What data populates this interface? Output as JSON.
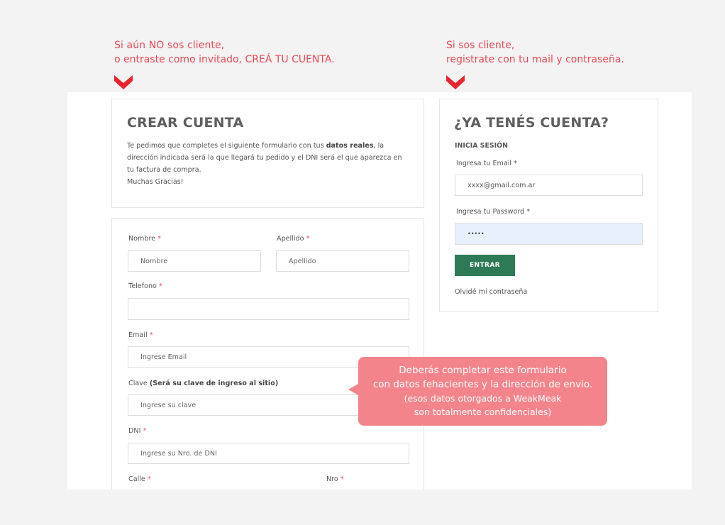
{
  "annotations": {
    "left": {
      "line1": "Si aún NO sos cliente,",
      "line2": "o entraste como invitado, CREÁ TU CUENTA."
    },
    "right": {
      "line1": "Si sos cliente,",
      "line2": "registrate con tu mail y contraseña."
    },
    "colors": {
      "accent": "#e94a54"
    }
  },
  "create_account": {
    "title": "CREAR CUENTA",
    "intro_before": "Te pedimos que completes el siguiente formulario con tus ",
    "intro_bold": "datos reales",
    "intro_after": ", la dirección indicada será la que llegará tu pedido y el DNI será el que aparezca en tu factura de compra.",
    "thanks": "Muchas Gracias!"
  },
  "form": {
    "required_mark": "*",
    "nombre": {
      "label": "Nombre",
      "placeholder": "Nombre"
    },
    "apellido": {
      "label": "Apellido",
      "placeholder": "Apellido"
    },
    "telefono": {
      "label": "Telefono",
      "placeholder": ""
    },
    "email": {
      "label": "Email",
      "placeholder": "Ingrese Email"
    },
    "clave": {
      "label": "Clave",
      "hint": "(Será su clave de ingreso al sitio)",
      "placeholder": "Ingrese su clave"
    },
    "dni": {
      "label": "DNI",
      "placeholder": "Ingrese su Nro. de DNI"
    },
    "calle": {
      "label": "Calle"
    },
    "nro": {
      "label": "Nro"
    }
  },
  "login": {
    "title": "¿YA TENÉS CUENTA?",
    "subtitle": "INICIA SESIÓN",
    "email_label": "Ingresa tu Email",
    "email_value": "xxxx@gmail.com.ar",
    "password_label": "Ingresa tu Password",
    "password_value": "•••••",
    "submit": "ENTRAR",
    "forgot": "Olvidé mi contraseña",
    "button_color": "#2e7a57"
  },
  "callout": {
    "line1": "Deberás completar este formulario",
    "line2": "con datos fehacientes y la dirección de envio.",
    "line3": "(esos datos otorgados a WeakMeak",
    "line4": "son totalmente confidenciales)",
    "color": "#f4848b"
  }
}
